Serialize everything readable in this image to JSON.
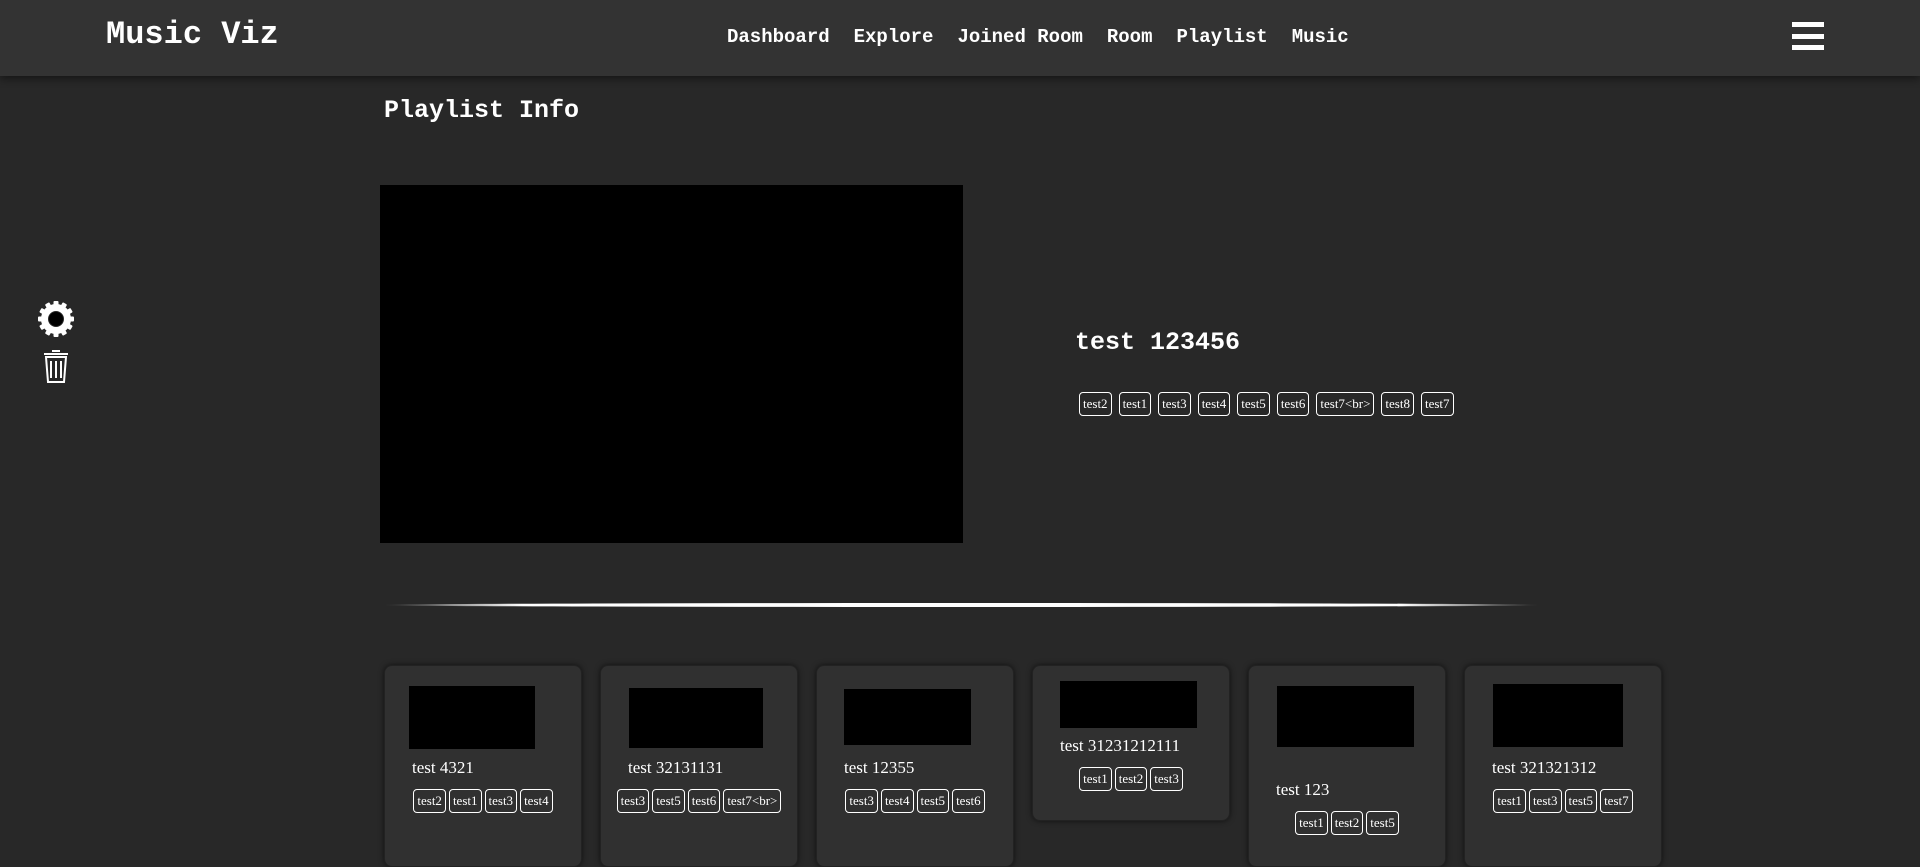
{
  "app": {
    "brand": "Music Viz"
  },
  "nav": {
    "links": [
      "Dashboard",
      "Explore",
      "Joined Room",
      "Room",
      "Playlist",
      "Music"
    ]
  },
  "page": {
    "title": "Playlist Info"
  },
  "icons": {
    "settings": "gear-icon",
    "delete": "trash-icon",
    "menu": "hamburger-icon"
  },
  "playlist": {
    "name": "test 123456",
    "tags": [
      "test2",
      "test1",
      "test3",
      "test4",
      "test5",
      "test6",
      "test7<br>",
      "test8",
      "test7"
    ]
  },
  "songs": [
    {
      "title": "test 4321",
      "tags": [
        "test2",
        "test1",
        "test3",
        "test4"
      ]
    },
    {
      "title": "test 32131131",
      "tags": [
        "test3",
        "test5",
        "test6",
        "test7<br>"
      ]
    },
    {
      "title": "test 12355",
      "tags": [
        "test3",
        "test4",
        "test5",
        "test6"
      ]
    },
    {
      "title": "test 31231212111",
      "tags": [
        "test1",
        "test2",
        "test3"
      ]
    },
    {
      "title": "test 123",
      "tags": [
        "test1",
        "test2",
        "test5"
      ]
    },
    {
      "title": "test 321321312",
      "tags": [
        "test1",
        "test3",
        "test5",
        "test7"
      ]
    }
  ],
  "colors": {
    "background": "#282828",
    "navbar": "#333333",
    "card": "#303030",
    "thumbnail": "#000000"
  }
}
